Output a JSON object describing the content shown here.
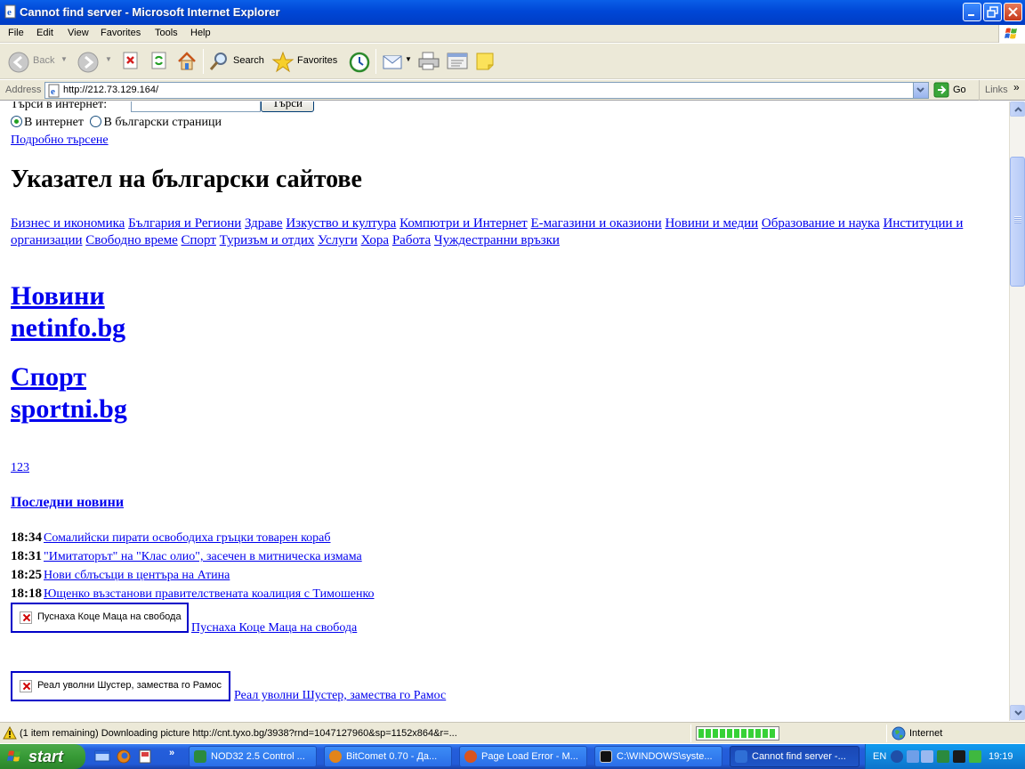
{
  "window": {
    "title": "Cannot find server - Microsoft Internet Explorer"
  },
  "menu": [
    "File",
    "Edit",
    "View",
    "Favorites",
    "Tools",
    "Help"
  ],
  "toolbar": {
    "back": "Back",
    "search": "Search",
    "favorites": "Favorites"
  },
  "address": {
    "label": "Address",
    "url": "http://212.73.129.164/",
    "go": "Go",
    "links": "Links"
  },
  "page": {
    "search_label": "Търси в интернет:",
    "search_button": "Търси",
    "radio_internet": "В интернет",
    "radio_bg": "В български страници",
    "advanced_search": "Подробно търсене",
    "directory_title": "Указател на български сайтове",
    "categories": [
      "Бизнес и икономика",
      "България и Региони",
      "Здраве",
      "Изкуство и култура",
      "Компютри и Интернет",
      "Е-магазини и оказиони",
      "Новини и медии",
      "Образование и наука",
      "Институции и организации",
      "Свободно време",
      "Спорт",
      "Туризъм и отдих",
      "Услуги",
      "Хора",
      "Работа",
      "Чуждестранни връзки"
    ],
    "news_heading": "Новини",
    "news_site": "netinfo.bg",
    "sport_heading": "Спорт",
    "sport_site": "sportni.bg",
    "counter_link": "123",
    "latest_news": "Последни новини",
    "news_items": [
      {
        "time": "18:34",
        "title": "Сомалийски пирати освободиха гръцки товарен кораб"
      },
      {
        "time": "18:31",
        "title": "\"Имитаторът\" на \"Клас олио\", засечен в митническа измама"
      },
      {
        "time": "18:25",
        "title": "Нови сблъсъци в центъра на Атина"
      },
      {
        "time": "18:18",
        "title": "Ющенко възстанови правителствената коалиция с Тимошенко"
      }
    ],
    "image_items": [
      {
        "alt": "Пуснаха Коце Маца на свобода",
        "link": "Пуснаха Коце Маца на свобода"
      },
      {
        "alt": "Реал уволни Шустер, замества го Рамос",
        "link": "Реал уволни Шустер, замества го Рамос"
      }
    ]
  },
  "status": {
    "text": "(1 item remaining) Downloading picture http://cnt.tyxo.bg/3938?rnd=1047127960&sp=1152x864&r=...",
    "zone": "Internet",
    "progress": 1.0
  },
  "taskbar": {
    "start": "start",
    "tasks": [
      {
        "label": "NOD32 2.5 Control ...",
        "color": "#2b8a3e"
      },
      {
        "label": "BitComet 0.70 - Да...",
        "color": "#e2841a"
      },
      {
        "label": "Page Load Error - M...",
        "color": "#d9541e"
      },
      {
        "label": "C:\\WINDOWS\\syste...",
        "color": "#111111"
      },
      {
        "label": "Cannot find server -...",
        "color": "#2f6fd6"
      }
    ],
    "lang": "EN",
    "clock": "19:19"
  },
  "colors": {
    "link": "#0000ee",
    "titlebar": "#0047d6",
    "taskbar": "#245edb",
    "start": "#379a36"
  }
}
